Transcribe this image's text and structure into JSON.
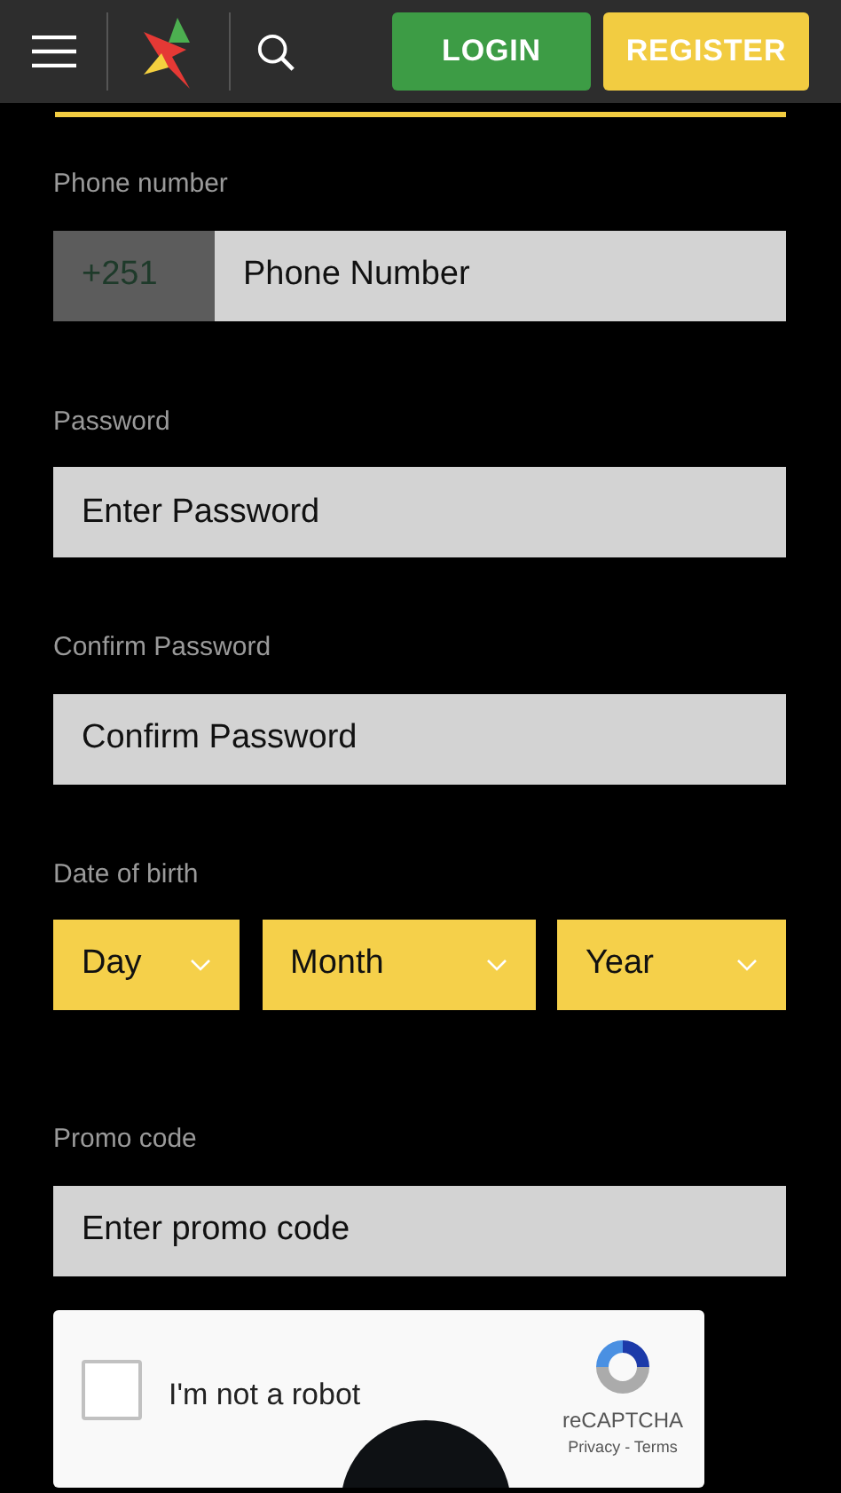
{
  "header": {
    "login": "LOGIN",
    "register": "REGISTER"
  },
  "phone": {
    "label": "Phone number",
    "prefix": "+251",
    "placeholder": "Phone Number"
  },
  "password": {
    "label": "Password",
    "placeholder": "Enter Password"
  },
  "confirm_password": {
    "label": "Confirm Password",
    "placeholder": "Confirm Password"
  },
  "date_of_birth": {
    "label": "Date of birth",
    "selects": [
      "Day",
      "Month",
      "Year"
    ]
  },
  "promo": {
    "label": "Promo code",
    "placeholder": "Enter promo code"
  },
  "captcha": {
    "label": "I'm not a robot",
    "checked": false,
    "brand": "reCAPTCHA",
    "links": "Privacy - Terms"
  }
}
